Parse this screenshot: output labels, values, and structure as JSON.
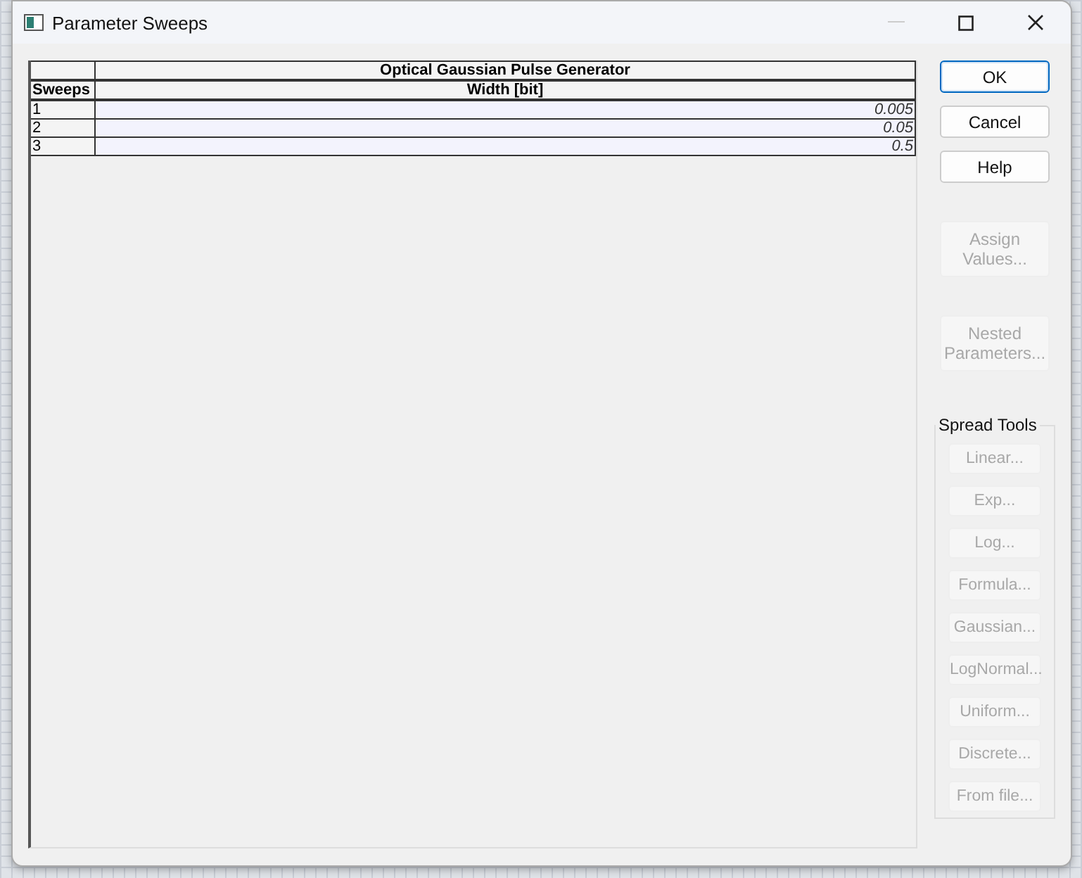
{
  "window": {
    "title": "Parameter Sweeps"
  },
  "table": {
    "group_header": "Optical Gaussian Pulse Generator",
    "columns": [
      "Sweeps",
      "Width [bit]"
    ],
    "rows": [
      {
        "index": "1",
        "value": "0.005"
      },
      {
        "index": "2",
        "value": "0.05"
      },
      {
        "index": "3",
        "value": "0.5"
      }
    ]
  },
  "buttons": [
    {
      "label": "OK",
      "default": true,
      "disabled": false
    },
    {
      "label": "Cancel",
      "default": false,
      "disabled": false
    },
    {
      "label": "Help",
      "default": false,
      "disabled": false
    },
    {
      "label": "Assign Values...",
      "default": false,
      "disabled": true
    },
    {
      "label": "Nested Parameters...",
      "default": false,
      "disabled": true
    }
  ],
  "spread_tools": {
    "title": "Spread Tools",
    "buttons": [
      {
        "label": "Linear...",
        "disabled": true
      },
      {
        "label": "Exp...",
        "disabled": true
      },
      {
        "label": "Log...",
        "disabled": true
      },
      {
        "label": "Formula...",
        "disabled": true
      },
      {
        "label": "Gaussian...",
        "disabled": true
      },
      {
        "label": "LogNormal...",
        "disabled": true
      },
      {
        "label": "Uniform...",
        "disabled": true
      },
      {
        "label": "Discrete...",
        "disabled": true
      },
      {
        "label": "From file...",
        "disabled": true
      }
    ]
  }
}
